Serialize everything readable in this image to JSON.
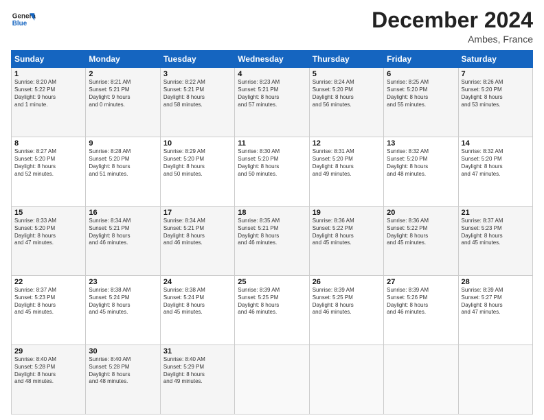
{
  "header": {
    "logo_line1": "General",
    "logo_line2": "Blue",
    "month": "December 2024",
    "location": "Ambes, France"
  },
  "days_of_week": [
    "Sunday",
    "Monday",
    "Tuesday",
    "Wednesday",
    "Thursday",
    "Friday",
    "Saturday"
  ],
  "weeks": [
    [
      {
        "day": "1",
        "info": "Sunrise: 8:20 AM\nSunset: 5:22 PM\nDaylight: 9 hours\nand 1 minute."
      },
      {
        "day": "2",
        "info": "Sunrise: 8:21 AM\nSunset: 5:21 PM\nDaylight: 9 hours\nand 0 minutes."
      },
      {
        "day": "3",
        "info": "Sunrise: 8:22 AM\nSunset: 5:21 PM\nDaylight: 8 hours\nand 58 minutes."
      },
      {
        "day": "4",
        "info": "Sunrise: 8:23 AM\nSunset: 5:21 PM\nDaylight: 8 hours\nand 57 minutes."
      },
      {
        "day": "5",
        "info": "Sunrise: 8:24 AM\nSunset: 5:20 PM\nDaylight: 8 hours\nand 56 minutes."
      },
      {
        "day": "6",
        "info": "Sunrise: 8:25 AM\nSunset: 5:20 PM\nDaylight: 8 hours\nand 55 minutes."
      },
      {
        "day": "7",
        "info": "Sunrise: 8:26 AM\nSunset: 5:20 PM\nDaylight: 8 hours\nand 53 minutes."
      }
    ],
    [
      {
        "day": "8",
        "info": "Sunrise: 8:27 AM\nSunset: 5:20 PM\nDaylight: 8 hours\nand 52 minutes."
      },
      {
        "day": "9",
        "info": "Sunrise: 8:28 AM\nSunset: 5:20 PM\nDaylight: 8 hours\nand 51 minutes."
      },
      {
        "day": "10",
        "info": "Sunrise: 8:29 AM\nSunset: 5:20 PM\nDaylight: 8 hours\nand 50 minutes."
      },
      {
        "day": "11",
        "info": "Sunrise: 8:30 AM\nSunset: 5:20 PM\nDaylight: 8 hours\nand 50 minutes."
      },
      {
        "day": "12",
        "info": "Sunrise: 8:31 AM\nSunset: 5:20 PM\nDaylight: 8 hours\nand 49 minutes."
      },
      {
        "day": "13",
        "info": "Sunrise: 8:32 AM\nSunset: 5:20 PM\nDaylight: 8 hours\nand 48 minutes."
      },
      {
        "day": "14",
        "info": "Sunrise: 8:32 AM\nSunset: 5:20 PM\nDaylight: 8 hours\nand 47 minutes."
      }
    ],
    [
      {
        "day": "15",
        "info": "Sunrise: 8:33 AM\nSunset: 5:20 PM\nDaylight: 8 hours\nand 47 minutes."
      },
      {
        "day": "16",
        "info": "Sunrise: 8:34 AM\nSunset: 5:21 PM\nDaylight: 8 hours\nand 46 minutes."
      },
      {
        "day": "17",
        "info": "Sunrise: 8:34 AM\nSunset: 5:21 PM\nDaylight: 8 hours\nand 46 minutes."
      },
      {
        "day": "18",
        "info": "Sunrise: 8:35 AM\nSunset: 5:21 PM\nDaylight: 8 hours\nand 46 minutes."
      },
      {
        "day": "19",
        "info": "Sunrise: 8:36 AM\nSunset: 5:22 PM\nDaylight: 8 hours\nand 45 minutes."
      },
      {
        "day": "20",
        "info": "Sunrise: 8:36 AM\nSunset: 5:22 PM\nDaylight: 8 hours\nand 45 minutes."
      },
      {
        "day": "21",
        "info": "Sunrise: 8:37 AM\nSunset: 5:23 PM\nDaylight: 8 hours\nand 45 minutes."
      }
    ],
    [
      {
        "day": "22",
        "info": "Sunrise: 8:37 AM\nSunset: 5:23 PM\nDaylight: 8 hours\nand 45 minutes."
      },
      {
        "day": "23",
        "info": "Sunrise: 8:38 AM\nSunset: 5:24 PM\nDaylight: 8 hours\nand 45 minutes."
      },
      {
        "day": "24",
        "info": "Sunrise: 8:38 AM\nSunset: 5:24 PM\nDaylight: 8 hours\nand 45 minutes."
      },
      {
        "day": "25",
        "info": "Sunrise: 8:39 AM\nSunset: 5:25 PM\nDaylight: 8 hours\nand 46 minutes."
      },
      {
        "day": "26",
        "info": "Sunrise: 8:39 AM\nSunset: 5:25 PM\nDaylight: 8 hours\nand 46 minutes."
      },
      {
        "day": "27",
        "info": "Sunrise: 8:39 AM\nSunset: 5:26 PM\nDaylight: 8 hours\nand 46 minutes."
      },
      {
        "day": "28",
        "info": "Sunrise: 8:39 AM\nSunset: 5:27 PM\nDaylight: 8 hours\nand 47 minutes."
      }
    ],
    [
      {
        "day": "29",
        "info": "Sunrise: 8:40 AM\nSunset: 5:28 PM\nDaylight: 8 hours\nand 48 minutes."
      },
      {
        "day": "30",
        "info": "Sunrise: 8:40 AM\nSunset: 5:28 PM\nDaylight: 8 hours\nand 48 minutes."
      },
      {
        "day": "31",
        "info": "Sunrise: 8:40 AM\nSunset: 5:29 PM\nDaylight: 8 hours\nand 49 minutes."
      },
      {
        "day": "",
        "info": ""
      },
      {
        "day": "",
        "info": ""
      },
      {
        "day": "",
        "info": ""
      },
      {
        "day": "",
        "info": ""
      }
    ]
  ]
}
